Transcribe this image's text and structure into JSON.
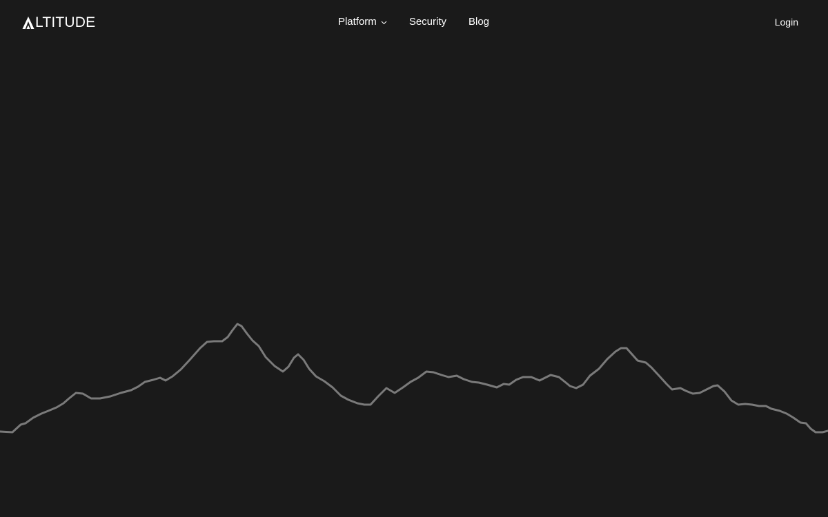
{
  "brand": {
    "name": "LTITUDE",
    "aria_label": "Altitude"
  },
  "nav": {
    "items": [
      {
        "label": "Platform",
        "has_dropdown": true
      },
      {
        "label": "Security",
        "has_dropdown": false
      },
      {
        "label": "Blog",
        "has_dropdown": false
      }
    ],
    "login_label": "Login"
  },
  "hero": {
    "graphic": "mountain-ridge-line"
  },
  "colors": {
    "background": "#1a1a1a",
    "text": "#ffffff",
    "ridge_line": "#7a7a7a"
  }
}
